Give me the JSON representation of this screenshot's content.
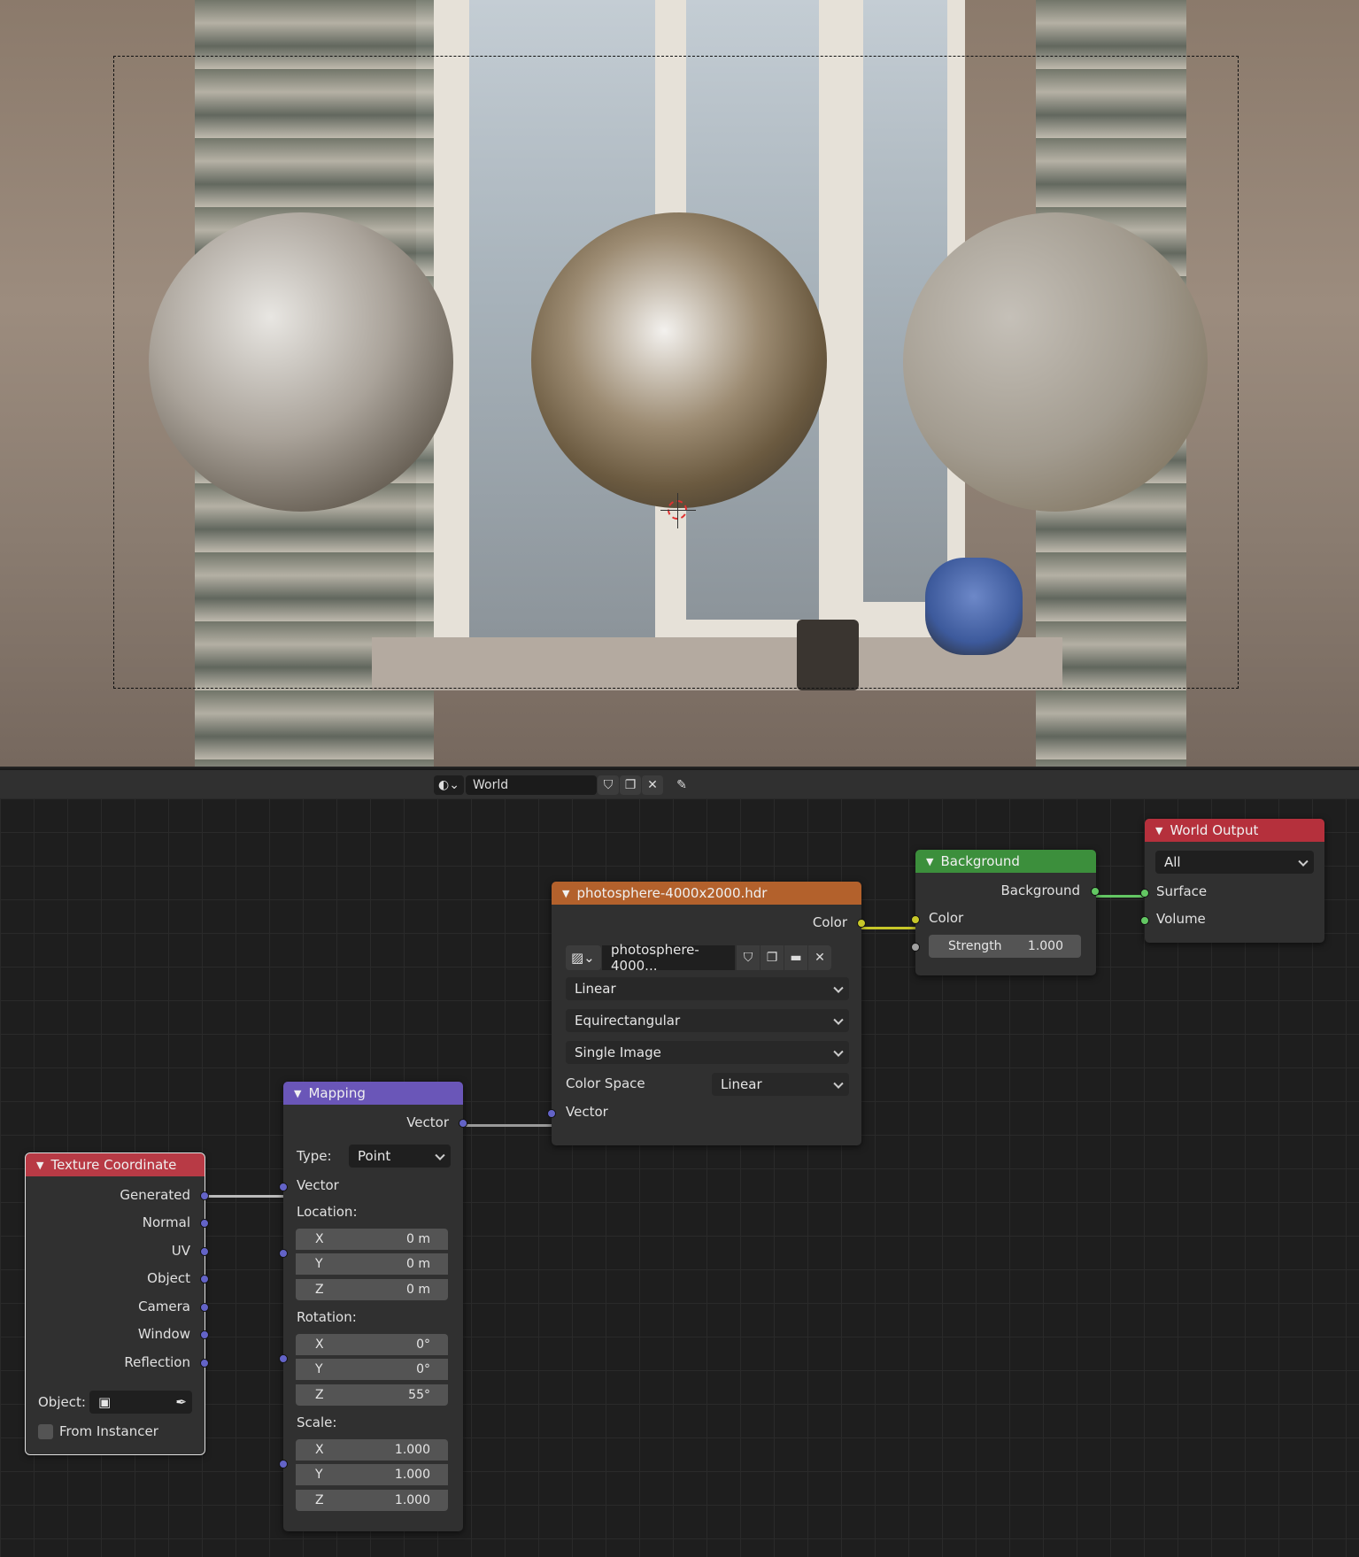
{
  "header": {
    "world_name": "World",
    "icons": [
      "world-icon",
      "fake-user-shield-icon",
      "duplicate-icon",
      "close-icon",
      "pin-icon"
    ]
  },
  "nodes": {
    "texture_coordinate": {
      "title": "Texture Coordinate",
      "outputs": [
        "Generated",
        "Normal",
        "UV",
        "Object",
        "Camera",
        "Window",
        "Reflection"
      ],
      "object_label": "Object:",
      "from_instancer": "From Instancer",
      "header_color": "#b83a45"
    },
    "mapping": {
      "title": "Mapping",
      "output": "Vector",
      "type_label": "Type:",
      "type_value": "Point",
      "input_vector": "Vector",
      "location_label": "Location:",
      "location": [
        {
          "axis": "X",
          "value": "0 m"
        },
        {
          "axis": "Y",
          "value": "0 m"
        },
        {
          "axis": "Z",
          "value": "0 m"
        }
      ],
      "rotation_label": "Rotation:",
      "rotation": [
        {
          "axis": "X",
          "value": "0°"
        },
        {
          "axis": "Y",
          "value": "0°"
        },
        {
          "axis": "Z",
          "value": "55°"
        }
      ],
      "scale_label": "Scale:",
      "scale": [
        {
          "axis": "X",
          "value": "1.000"
        },
        {
          "axis": "Y",
          "value": "1.000"
        },
        {
          "axis": "Z",
          "value": "1.000"
        }
      ],
      "header_color": "#6a56b8"
    },
    "environment_texture": {
      "title": "photosphere-4000x2000.hdr",
      "output": "Color",
      "image_name": "photosphere-4000...",
      "interpolation": "Linear",
      "projection": "Equirectangular",
      "source": "Single Image",
      "color_space_label": "Color Space",
      "color_space": "Linear",
      "input_vector": "Vector",
      "header_color": "#b3612c"
    },
    "background": {
      "title": "Background",
      "output": "Background",
      "color_label": "Color",
      "strength_label": "Strength",
      "strength_value": "1.000",
      "header_color": "#3c8f3c"
    },
    "world_output": {
      "title": "World Output",
      "target": "All",
      "surface": "Surface",
      "volume": "Volume",
      "header_color": "#b5303c"
    }
  }
}
